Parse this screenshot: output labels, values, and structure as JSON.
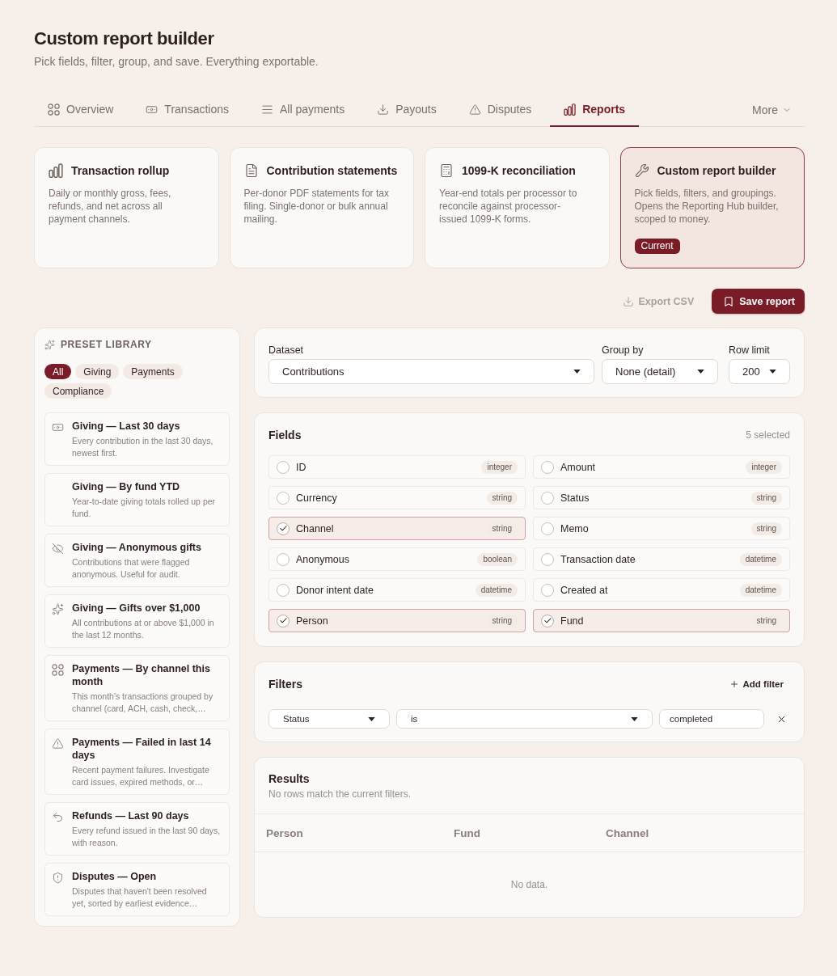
{
  "header": {
    "title": "Custom report builder",
    "subtitle": "Pick fields, filter, group, and save. Everything exportable."
  },
  "tabs": [
    {
      "label": "Overview",
      "selected": false
    },
    {
      "label": "Transactions",
      "selected": false
    },
    {
      "label": "All payments",
      "selected": false
    },
    {
      "label": "Payouts",
      "selected": false
    },
    {
      "label": "Disputes",
      "selected": false
    },
    {
      "label": "Reports",
      "selected": true
    }
  ],
  "more_menu": {
    "label": "More"
  },
  "report_cards": [
    {
      "title": "Transaction rollup",
      "description": "Daily or monthly gross, fees, refunds, and net across all payment channels.",
      "selected": false
    },
    {
      "title": "Contribution statements",
      "description": "Per-donor PDF statements for tax filing. Single-donor or bulk annual mailing.",
      "selected": false
    },
    {
      "title": "1099-K reconciliation",
      "description": "Year-end totals per processor to reconcile against processor-issued 1099-K forms.",
      "selected": false
    },
    {
      "title": "Custom report builder",
      "description": "Pick fields, filters, and groupings. Opens the Reporting Hub builder, scoped to money.",
      "selected": true,
      "badge": "Current"
    }
  ],
  "actions": {
    "export": {
      "label": "Export CSV",
      "disabled": true
    },
    "save": {
      "label": "Save report"
    }
  },
  "preset_library": {
    "title": "PRESET LIBRARY",
    "chips": [
      {
        "label": "All",
        "selected": true
      },
      {
        "label": "Giving",
        "selected": false
      },
      {
        "label": "Payments",
        "selected": false
      },
      {
        "label": "Compliance",
        "selected": false
      }
    ],
    "presets": [
      {
        "title": "Giving — Last 30 days",
        "description": "Every contribution in the last 30 days, newest first."
      },
      {
        "title": "Giving — By fund YTD",
        "description": "Year-to-date giving totals rolled up per fund."
      },
      {
        "title": "Giving — Anonymous gifts",
        "description": "Contributions that were flagged anonymous. Useful for audit."
      },
      {
        "title": "Giving — Gifts over $1,000",
        "description": "All contributions at or above $1,000 in the last 12 months."
      },
      {
        "title": "Payments — By channel this month",
        "description": "This month's transactions grouped by channel (card, ACH, cash, check,…"
      },
      {
        "title": "Payments — Failed in last 14 days",
        "description": "Recent payment failures. Investigate card issues, expired methods, or…"
      },
      {
        "title": "Refunds — Last 90 days",
        "description": "Every refund issued in the last 90 days, with reason."
      },
      {
        "title": "Disputes — Open",
        "description": "Disputes that haven't been resolved yet, sorted by earliest evidence…"
      }
    ]
  },
  "settings": {
    "selects": [
      {
        "label": "Dataset",
        "value": "Contributions"
      },
      {
        "label": "Group by",
        "value": "None (detail)"
      },
      {
        "label": "Row limit",
        "value": "200"
      }
    ]
  },
  "fields": {
    "title": "Fields",
    "count": "5 selected",
    "items": [
      {
        "name": "ID",
        "type": "integer",
        "checked": false
      },
      {
        "name": "Amount",
        "type": "integer",
        "checked": false
      },
      {
        "name": "Currency",
        "type": "string",
        "checked": false
      },
      {
        "name": "Status",
        "type": "string",
        "checked": false
      },
      {
        "name": "Channel",
        "type": "string",
        "checked": true
      },
      {
        "name": "Memo",
        "type": "string",
        "checked": false
      },
      {
        "name": "Anonymous",
        "type": "boolean",
        "checked": false
      },
      {
        "name": "Transaction date",
        "type": "datetime",
        "checked": false
      },
      {
        "name": "Donor intent date",
        "type": "datetime",
        "checked": false
      },
      {
        "name": "Created at",
        "type": "datetime",
        "checked": false
      },
      {
        "name": "Person",
        "type": "string",
        "checked": true
      },
      {
        "name": "Fund",
        "type": "string",
        "checked": true
      }
    ]
  },
  "filters": {
    "title": "Filters",
    "add_label": "Add filter",
    "rows": [
      {
        "field": "Status",
        "operator": "is",
        "value": "completed"
      }
    ]
  },
  "results": {
    "title": "Results",
    "subtitle": "No rows match the current filters.",
    "columns": [
      "Person",
      "Fund",
      "Channel"
    ],
    "empty": "No data."
  }
}
